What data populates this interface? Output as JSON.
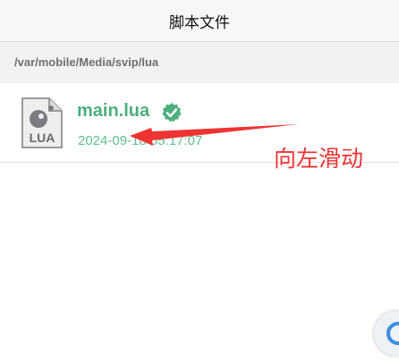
{
  "navbar": {
    "title": "脚本文件"
  },
  "path": "/var/mobile/Media/svip/lua",
  "files": [
    {
      "name": "main.lua",
      "date": "2024-09-18 05:17:07",
      "icon_label": "LUA",
      "verified": true
    }
  ],
  "annotation": {
    "text": "向左滑动",
    "color": "#ee3333"
  },
  "colors": {
    "accent_green": "#4caf7d",
    "assistive_blue": "#3b8fe0"
  }
}
